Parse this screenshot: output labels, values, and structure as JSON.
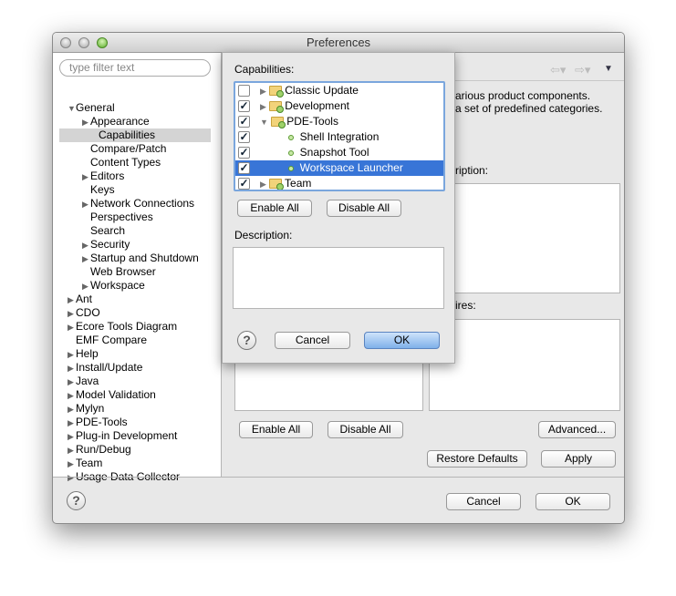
{
  "window": {
    "title": "Preferences"
  },
  "filter": {
    "placeholder": "type filter text"
  },
  "nav_tree": [
    {
      "label": "General",
      "level": 0,
      "expanded": true
    },
    {
      "label": "Appearance",
      "level": 1,
      "expandable": true
    },
    {
      "label": "Capabilities",
      "level": 1,
      "selected": true
    },
    {
      "label": "Compare/Patch",
      "level": 1
    },
    {
      "label": "Content Types",
      "level": 1
    },
    {
      "label": "Editors",
      "level": 1,
      "expandable": true
    },
    {
      "label": "Keys",
      "level": 1
    },
    {
      "label": "Network Connections",
      "level": 1,
      "expandable": true
    },
    {
      "label": "Perspectives",
      "level": 1
    },
    {
      "label": "Search",
      "level": 1
    },
    {
      "label": "Security",
      "level": 1,
      "expandable": true
    },
    {
      "label": "Startup and Shutdown",
      "level": 1,
      "expandable": true
    },
    {
      "label": "Web Browser",
      "level": 1
    },
    {
      "label": "Workspace",
      "level": 1,
      "expandable": true
    },
    {
      "label": "Ant",
      "level": 0,
      "expandable": true
    },
    {
      "label": "CDO",
      "level": 0,
      "expandable": true
    },
    {
      "label": "Ecore Tools Diagram",
      "level": 0,
      "expandable": true
    },
    {
      "label": "EMF Compare",
      "level": 0
    },
    {
      "label": "Help",
      "level": 0,
      "expandable": true
    },
    {
      "label": "Install/Update",
      "level": 0,
      "expandable": true
    },
    {
      "label": "Java",
      "level": 0,
      "expandable": true
    },
    {
      "label": "Model Validation",
      "level": 0,
      "expandable": true
    },
    {
      "label": "Mylyn",
      "level": 0,
      "expandable": true
    },
    {
      "label": "PDE-Tools",
      "level": 0,
      "expandable": true
    },
    {
      "label": "Plug-in Development",
      "level": 0,
      "expandable": true
    },
    {
      "label": "Run/Debug",
      "level": 0,
      "expandable": true
    },
    {
      "label": "Team",
      "level": 0,
      "expandable": true
    },
    {
      "label": "Usage Data Collector",
      "level": 0,
      "expandable": true
    }
  ],
  "page": {
    "intro_line1": "arious product components.",
    "intro_line2": "a set of predefined categories.",
    "description_label": "ription:",
    "requires_label": "ires:",
    "enable_all": "Enable All",
    "disable_all": "Disable All",
    "advanced": "Advanced...",
    "restore_defaults": "Restore Defaults",
    "apply": "Apply"
  },
  "footer": {
    "cancel": "Cancel",
    "ok": "OK"
  },
  "popup": {
    "capabilities_label": "Capabilities:",
    "items": [
      {
        "label": "Classic Update",
        "checked": false,
        "type": "folder",
        "expanded": false
      },
      {
        "label": "Development",
        "checked": true,
        "type": "folder",
        "expanded": false
      },
      {
        "label": "PDE-Tools",
        "checked": true,
        "type": "folder",
        "expanded": true
      },
      {
        "label": "Shell Integration",
        "checked": true,
        "type": "leaf"
      },
      {
        "label": "Snapshot Tool",
        "checked": true,
        "type": "leaf"
      },
      {
        "label": "Workspace Launcher",
        "checked": true,
        "type": "leaf",
        "selected": true
      },
      {
        "label": "Team",
        "checked": true,
        "type": "folder",
        "expanded": false
      }
    ],
    "enable_all": "Enable All",
    "disable_all": "Disable All",
    "description_label": "Description:",
    "cancel": "Cancel",
    "ok": "OK"
  },
  "colors": {
    "selection": "#3875d7",
    "default_button": "#7fb0ea"
  }
}
